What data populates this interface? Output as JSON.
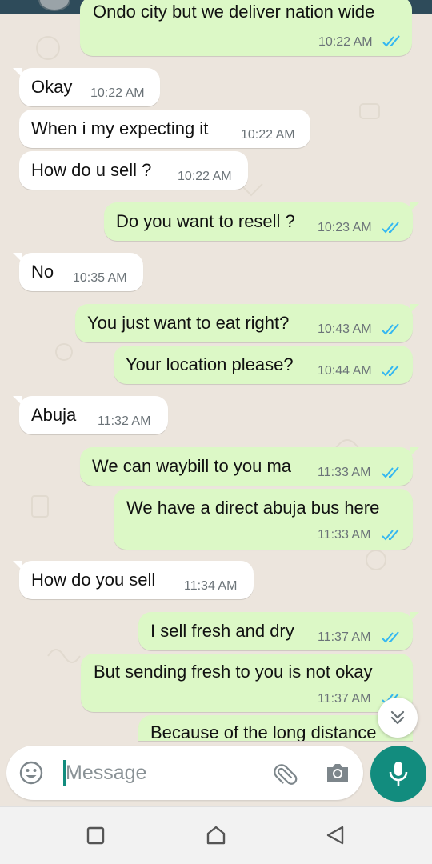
{
  "messages": [
    {
      "dir": "out",
      "text": "Ondo city but we deliver nation wide",
      "time": "10:22 AM",
      "ticks": true
    },
    {
      "dir": "in",
      "text": "Okay",
      "time": "10:22 AM"
    },
    {
      "dir": "in",
      "text": "When i my expecting it",
      "time": "10:22 AM"
    },
    {
      "dir": "in",
      "text": "How do u sell ?",
      "time": "10:22 AM"
    },
    {
      "dir": "out",
      "text": "Do you want to resell ?",
      "time": "10:23 AM",
      "ticks": true
    },
    {
      "dir": "in",
      "text": "No",
      "time": "10:35 AM"
    },
    {
      "dir": "out",
      "text": "You just want to eat right?",
      "time": "10:43 AM",
      "ticks": true
    },
    {
      "dir": "out",
      "text": "Your location please?",
      "time": "10:44 AM",
      "ticks": true
    },
    {
      "dir": "in",
      "text": "Abuja",
      "time": "11:32 AM"
    },
    {
      "dir": "out",
      "text": "We can waybill to you ma",
      "time": "11:33 AM",
      "ticks": true
    },
    {
      "dir": "out",
      "text": "We have a direct abuja bus here",
      "time": "11:33 AM",
      "ticks": true
    },
    {
      "dir": "in",
      "text": "How do you sell",
      "time": "11:34 AM"
    },
    {
      "dir": "out",
      "text": "I sell fresh and dry",
      "time": "11:37 AM",
      "ticks": true
    },
    {
      "dir": "out",
      "text": "But sending fresh to you is not okay",
      "time": "11:37 AM",
      "ticks": true
    },
    {
      "dir": "out",
      "text": "Because of the long distance",
      "time": "",
      "ticks": false
    }
  ],
  "composer": {
    "placeholder": "Message"
  },
  "colors": {
    "incoming": "#FFFFFF",
    "outgoing": "#DCF8C6",
    "accent": "#128C7E",
    "read_ticks": "#34B7F1",
    "background": "#ECE5DD"
  },
  "icons": {
    "emoji": "emoji-icon",
    "attach": "paperclip-icon",
    "camera": "camera-icon",
    "mic": "mic-icon",
    "scroll": "double-chevron-down-icon",
    "nav_recents": "square-icon",
    "nav_home": "home-icon",
    "nav_back": "back-triangle-icon"
  }
}
